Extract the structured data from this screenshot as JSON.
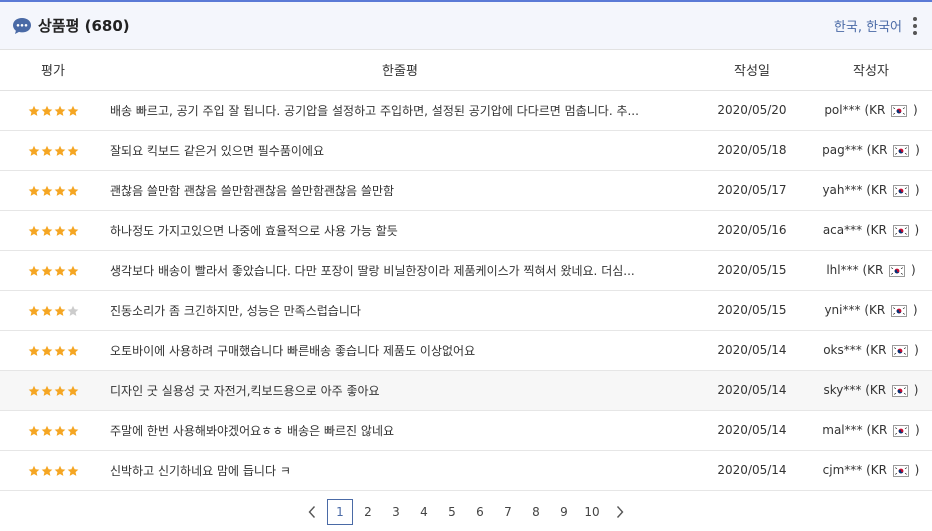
{
  "header": {
    "title": "상품평",
    "count": "(680)",
    "locale": "한국, 한국어"
  },
  "columns": {
    "rating": "평가",
    "review": "한줄평",
    "date": "작성일",
    "author": "작성자"
  },
  "reviews": [
    {
      "rating": 4,
      "text": "배송 빠르고, 공기 주입 잘 됩니다. 공기압을 설정하고 주입하면, 설정된 공기압에 다다르면 멈춥니다. 추...",
      "date": "2020/05/20",
      "author_name": "pol***",
      "author_country_open": "(KR",
      "author_country_close": ")"
    },
    {
      "rating": 4,
      "text": "잘되요 킥보드 같은거 있으면 필수품이에요",
      "date": "2020/05/18",
      "author_name": "pag***",
      "author_country_open": "(KR",
      "author_country_close": ")"
    },
    {
      "rating": 4,
      "text": "괜찮음 쓸만함 괜찮음 쓸만함괜찮음 쓸만함괜찮음 쓸만함",
      "date": "2020/05/17",
      "author_name": "yah***",
      "author_country_open": "(KR",
      "author_country_close": ")"
    },
    {
      "rating": 4,
      "text": "하나정도 가지고있으면 나중에 효율적으로 사용 가능 할듯",
      "date": "2020/05/16",
      "author_name": "aca***",
      "author_country_open": "(KR",
      "author_country_close": ")"
    },
    {
      "rating": 4,
      "text": "생각보다 배송이 빨라서 좋았습니다. 다만 포장이 딸랑 비닐한장이라 제품케이스가 찍혀서 왔네요. 더심...",
      "date": "2020/05/15",
      "author_name": "lhl***",
      "author_country_open": "(KR",
      "author_country_close": ")"
    },
    {
      "rating": 3,
      "text": "진동소리가 좀 크긴하지만, 성능은 만족스럽습니다",
      "date": "2020/05/15",
      "author_name": "yni***",
      "author_country_open": "(KR",
      "author_country_close": ")"
    },
    {
      "rating": 4,
      "text": "오토바이에 사용하려 구매했습니다 빠른배송 좋습니다 제품도 이상없어요",
      "date": "2020/05/14",
      "author_name": "oks***",
      "author_country_open": "(KR",
      "author_country_close": ")"
    },
    {
      "rating": 4,
      "text": "디자인 굿 실용성 굿 자전거,킥보드용으로 아주 좋아요",
      "date": "2020/05/14",
      "author_name": "sky***",
      "author_country_open": "(KR",
      "author_country_close": ")"
    },
    {
      "rating": 4,
      "text": "주말에 한번 사용해봐야겠어요ㅎㅎ 배송은 빠르진 않네요",
      "date": "2020/05/14",
      "author_name": "mal***",
      "author_country_open": "(KR",
      "author_country_close": ")"
    },
    {
      "rating": 4,
      "text": "신박하고 신기하네요 맘에 듭니다 ㅋ",
      "date": "2020/05/14",
      "author_name": "cjm***",
      "author_country_open": "(KR",
      "author_country_close": ")"
    }
  ],
  "rating_max": 4,
  "highlighted_row": 7,
  "pagination": {
    "pages": [
      "1",
      "2",
      "3",
      "4",
      "5",
      "6",
      "7",
      "8",
      "9",
      "10"
    ],
    "current": "1"
  },
  "colors": {
    "accent": "#4a6aa6",
    "star_filled": "#f5a623",
    "star_empty": "#cccccc",
    "header_bg": "#f4f6fc",
    "top_border": "#5b7ad6"
  },
  "icons": {
    "header": "chat-bubble-icon",
    "menu": "kebab-menu-icon",
    "prev": "chevron-left-icon",
    "next": "chevron-right-icon",
    "flag": "korea-flag-icon",
    "star": "star-icon"
  }
}
